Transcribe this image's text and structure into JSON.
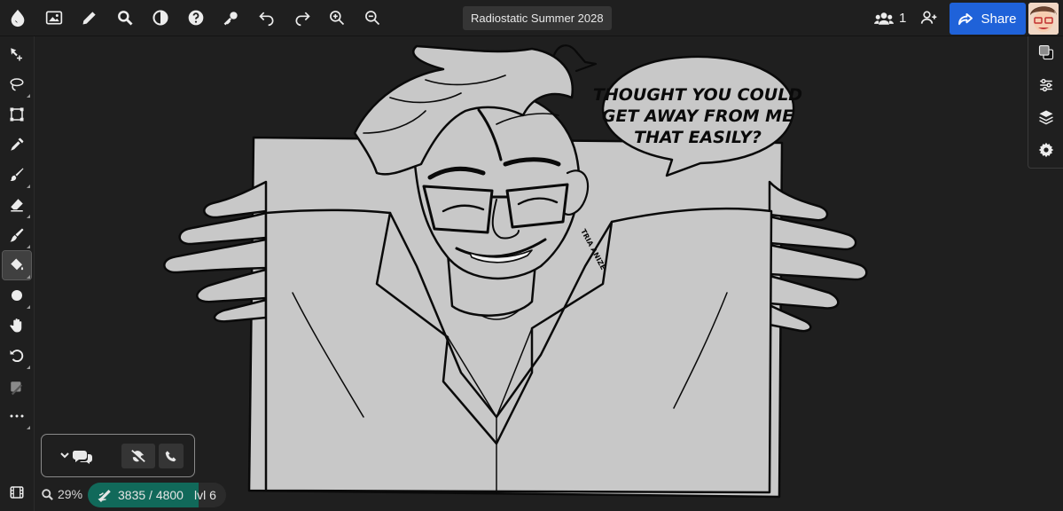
{
  "header": {
    "document_title": "Radiostatic Summer 2028",
    "online_count": "1",
    "share_label": "Share"
  },
  "status": {
    "zoom": "29%",
    "xp_current": 3835,
    "xp_total": 4800,
    "xp_text": "3835 / 4800",
    "level_text": "lvl 6"
  },
  "canvas": {
    "speech_bubble_lines": [
      "THOUGHT YOU COULD",
      "GET AWAY FROM ME",
      "THAT EASILY?"
    ],
    "signature": "TRIA ANIZE"
  },
  "colors": {
    "accent": "#1f62d9",
    "xp_bar": "#11695a",
    "canvas_fill": "#c8c8c8",
    "background": "#1f1f1f"
  }
}
